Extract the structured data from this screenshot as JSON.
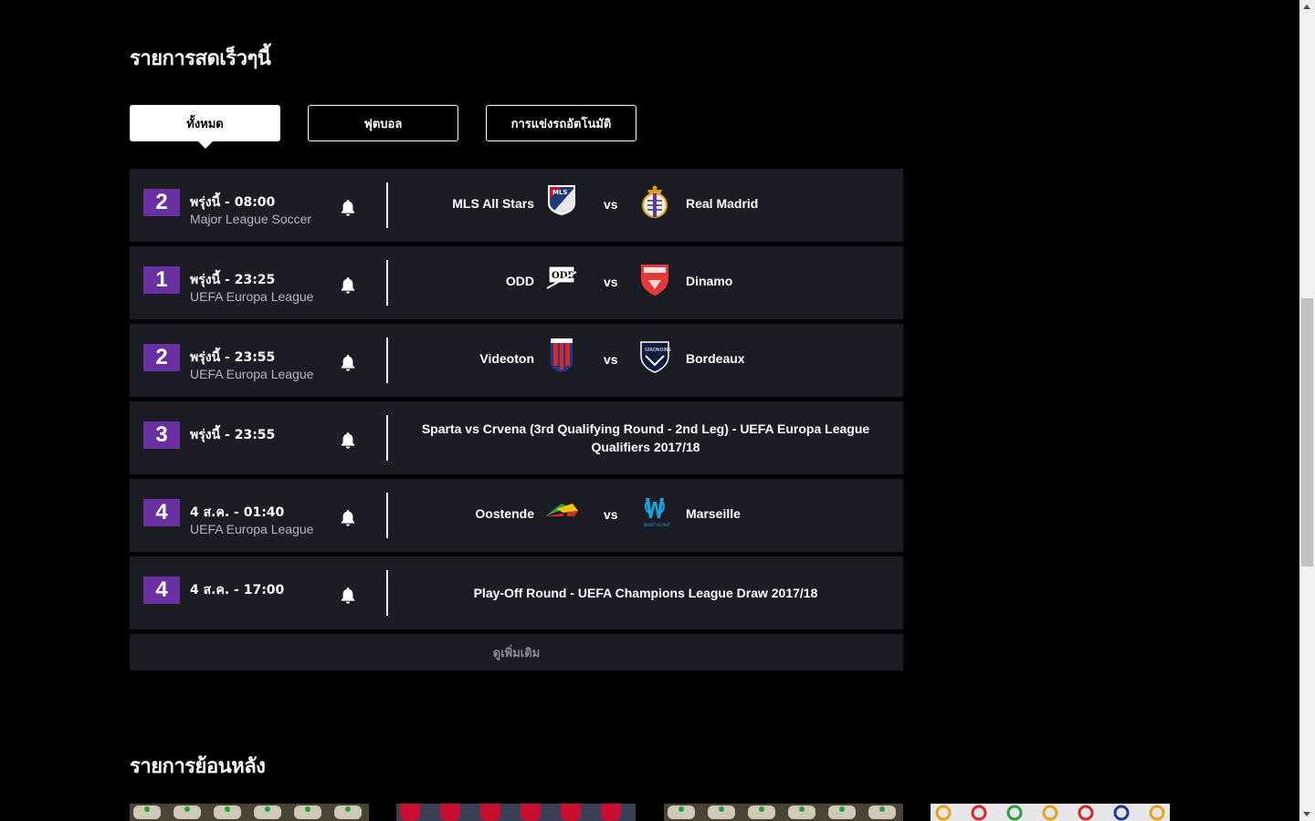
{
  "live_section": {
    "title": "รายการสดเร็วๆนี้",
    "tabs": [
      {
        "label": "ทั้งหมด",
        "active": true
      },
      {
        "label": "ฟุตบอล",
        "active": false
      },
      {
        "label": "การแข่งรถอัตโนมัติ",
        "active": false
      }
    ],
    "rows": [
      {
        "channel": "2",
        "time": "พรุ่งนี้ - 08:00",
        "league": "Major League Soccer",
        "home": "MLS All Stars",
        "vs": "vs",
        "away": "Real Madrid",
        "home_logo": "mls-logo",
        "away_logo": "real-madrid-logo"
      },
      {
        "channel": "1",
        "time": "พรุ่งนี้ - 23:25",
        "league": "UEFA Europa League",
        "home": "ODD",
        "vs": "vs",
        "away": "Dinamo",
        "home_logo": "odd-logo",
        "away_logo": "dinamo-logo"
      },
      {
        "channel": "2",
        "time": "พรุ่งนี้ - 23:55",
        "league": "UEFA Europa League",
        "home": "Videoton",
        "vs": "vs",
        "away": "Bordeaux",
        "home_logo": "videoton-logo",
        "away_logo": "bordeaux-logo"
      },
      {
        "channel": "3",
        "time": "พรุ่งนี้ - 23:55",
        "league": "",
        "event": "Sparta vs Crvena (3rd Qualifying Round - 2nd Leg) - UEFA Europa League Qualifiers 2017/18"
      },
      {
        "channel": "4",
        "time": "4 ส.ค. - 01:40",
        "league": "UEFA Europa League",
        "home": "Oostende",
        "vs": "vs",
        "away": "Marseille",
        "home_logo": "oostende-logo",
        "away_logo": "marseille-logo"
      },
      {
        "channel": "4",
        "time": "4 ส.ค. - 17:00",
        "league": "",
        "event": "Play-Off Round - UEFA Champions League Draw 2017/18"
      }
    ],
    "more_label": "ดูเพิ่มเติม",
    "bell_icon": "bell-icon"
  },
  "past_section": {
    "title": "รายการย้อนหลัง"
  },
  "colors": {
    "background": "#000000",
    "row_bg": "#1b1c24",
    "channel_badge": "#6a2fa0",
    "muted_text": "#b6b6bd"
  }
}
